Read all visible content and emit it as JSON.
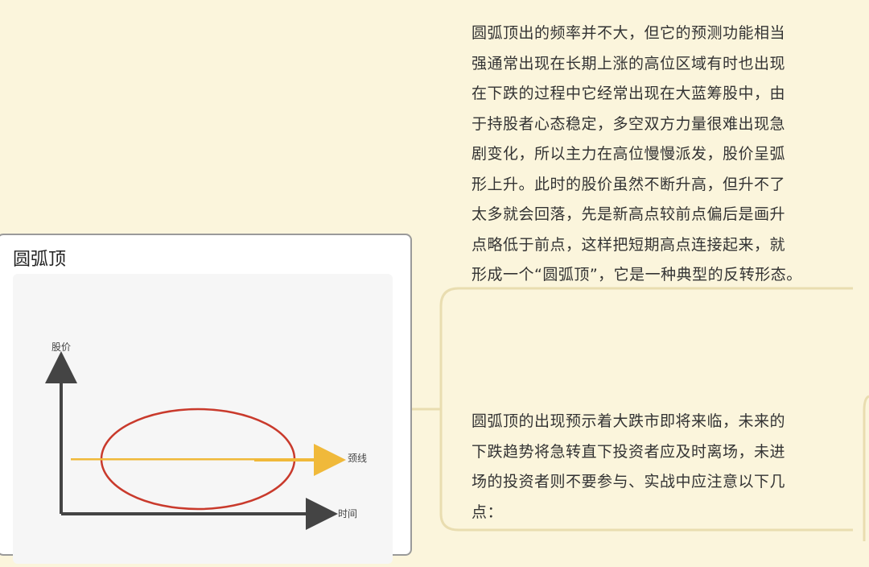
{
  "card": {
    "title": "圆弧顶",
    "diagram": {
      "y_label": "股价",
      "x_label": "时间",
      "line_label": "颈线"
    }
  },
  "paragraphs": [
    {
      "lines": [
        "圆弧顶出的频率并不大，但它的预测功能相当",
        "强通常出现在长期上涨的高位区域有时也出现",
        "在下跌的过程中它经常出现在大蓝筹股中，由",
        "于持股者心态稳定，多空双方力量很难出现急",
        "剧变化，所以主力在高位慢慢派发，股价呈弧",
        "形上升。此时的股价虽然不断升高，但升不了",
        "太多就会回落，先是新高点较前点偏后是画升",
        "点略低于前点，这样把短期高点连接起来，就",
        "形成一个“圆弧顶”，它是一种典型的反转形态。"
      ]
    },
    {
      "lines": [
        "圆弧顶的出现预示着大跌市即将来临，未来的",
        "下跌趋势将急转直下投资者应及时离场，未进",
        "场的投资者则不要参与、实战中应注意以下几",
        "点："
      ]
    }
  ],
  "colors": {
    "background": "#fbf5dc",
    "connector": "#e9ddb0",
    "neckline": "#f0b93a",
    "ellipse": "#c93a2c",
    "axis": "#444444"
  }
}
